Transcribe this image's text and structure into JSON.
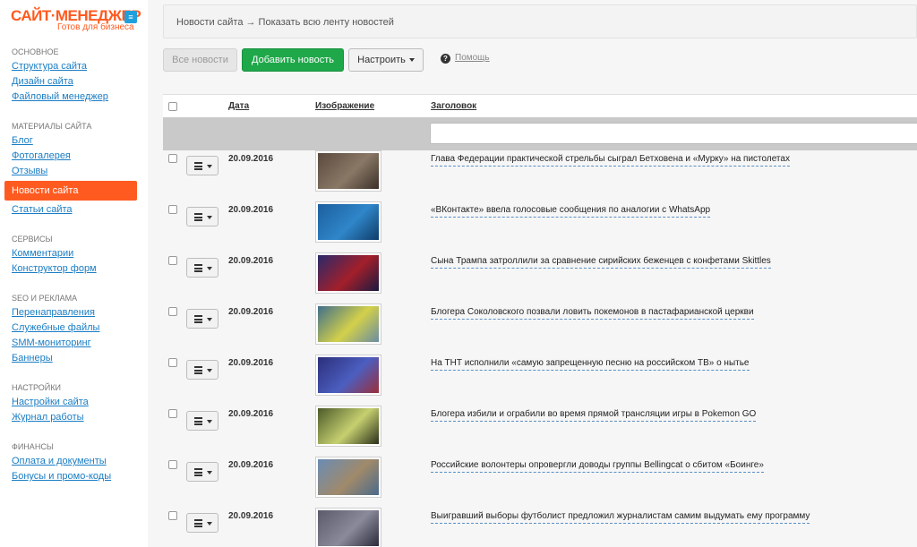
{
  "logo": {
    "name": "САЙТ·МЕНЕДЖЕР",
    "tagline": "Готов для бизнеса",
    "badge": "≡"
  },
  "sidebar": {
    "sections": [
      {
        "title": "ОСНОВНОЕ",
        "items": [
          {
            "label": "Структура сайта"
          },
          {
            "label": "Дизайн сайта"
          },
          {
            "label": "Файловый менеджер"
          }
        ]
      },
      {
        "title": "МАТЕРИАЛЫ САЙТА",
        "items": [
          {
            "label": "Блог"
          },
          {
            "label": "Фотогалерея"
          },
          {
            "label": "Отзывы"
          },
          {
            "label": "Новости сайта",
            "active": true
          },
          {
            "label": "Статьи сайта"
          }
        ]
      },
      {
        "title": "СЕРВИСЫ",
        "items": [
          {
            "label": "Комментарии"
          },
          {
            "label": "Конструктор форм"
          }
        ]
      },
      {
        "title": "SEO И РЕКЛАМА",
        "items": [
          {
            "label": "Перенаправления"
          },
          {
            "label": "Служебные файлы"
          },
          {
            "label": "SMM-мониторинг"
          },
          {
            "label": "Баннеры"
          }
        ]
      },
      {
        "title": "НАСТРОЙКИ",
        "items": [
          {
            "label": "Настройки сайта"
          },
          {
            "label": "Журнал работы"
          }
        ]
      },
      {
        "title": "ФИНАНСЫ",
        "items": [
          {
            "label": "Оплата и документы"
          },
          {
            "label": "Бонусы и промо-коды"
          }
        ]
      }
    ]
  },
  "breadcrumb": "Новости сайта → Показать всю ленту новостей",
  "toolbar": {
    "all_label": "Все новости",
    "add_label": "Добавить новость",
    "settings_label": "Настроить",
    "help_label": "Помощь"
  },
  "table": {
    "headers": {
      "date": "Дата",
      "image": "Изображение",
      "title": "Заголовок"
    },
    "filter": {
      "value": "",
      "placeholder": ""
    },
    "rows": [
      {
        "date": "20.09.2016",
        "title": "Глава Федерации практической стрельбы сыграл Бетховена и «Мурку» на пистолетах",
        "colors": [
          "#5a4a3e",
          "#8a7866",
          "#3b3029"
        ]
      },
      {
        "date": "20.09.2016",
        "title": "«ВКонтакте» ввела голосовые сообщения по аналогии с WhatsApp",
        "colors": [
          "#1c5f9e",
          "#2f86c9",
          "#0f3c69"
        ]
      },
      {
        "date": "20.09.2016",
        "title": "Сына Трампа затроллили за сравнение сирийских беженцев с конфетами Skittles",
        "colors": [
          "#2a2a6a",
          "#a31f2a",
          "#1a1a40"
        ]
      },
      {
        "date": "20.09.2016",
        "title": "Блогера Соколовского позвали ловить покемонов в пастафарианской церкви",
        "colors": [
          "#3f6f8c",
          "#d3d04a",
          "#6a8ca2"
        ]
      },
      {
        "date": "20.09.2016",
        "title": "На ТНТ исполнили «самую запрещенную песню на российском ТВ» о нытье",
        "colors": [
          "#2b2f7a",
          "#4c5ec0",
          "#9a2f3a"
        ]
      },
      {
        "date": "20.09.2016",
        "title": "Блогера избили и ограбили во время прямой трансляции игры в Pokemon GO",
        "colors": [
          "#4c5a2a",
          "#c6d070",
          "#2b2f1a"
        ]
      },
      {
        "date": "20.09.2016",
        "title": "Российские волонтеры опровергли доводы группы Bellingcat о сбитом «Боинге»",
        "colors": [
          "#6a8cb4",
          "#a08a6a",
          "#4a6a8a"
        ]
      },
      {
        "date": "20.09.2016",
        "title": "Выигравший выборы футболист предложил журналистам самим выдумать ему программу",
        "colors": [
          "#5a5a6a",
          "#8a8a9a",
          "#2a2a3a"
        ]
      }
    ]
  }
}
